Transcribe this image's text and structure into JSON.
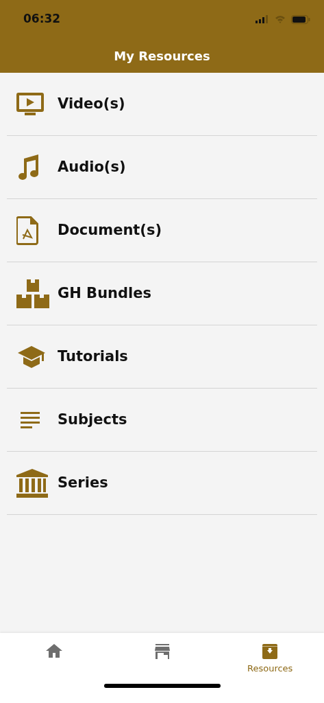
{
  "status_bar": {
    "time": "06:32"
  },
  "header": {
    "title": "My Resources"
  },
  "items": [
    {
      "kind": "video",
      "label": "Video(s)"
    },
    {
      "kind": "audio",
      "label": "Audio(s)"
    },
    {
      "kind": "document",
      "label": "Document(s)"
    },
    {
      "kind": "bundles",
      "label": "GH Bundles"
    },
    {
      "kind": "tutorials",
      "label": "Tutorials"
    },
    {
      "kind": "subjects",
      "label": "Subjects"
    },
    {
      "kind": "series",
      "label": "Series"
    }
  ],
  "tab_bar": [
    {
      "kind": "home",
      "selected": false
    },
    {
      "kind": "store",
      "selected": false
    },
    {
      "kind": "resources",
      "label": "Resources",
      "selected": true
    }
  ]
}
